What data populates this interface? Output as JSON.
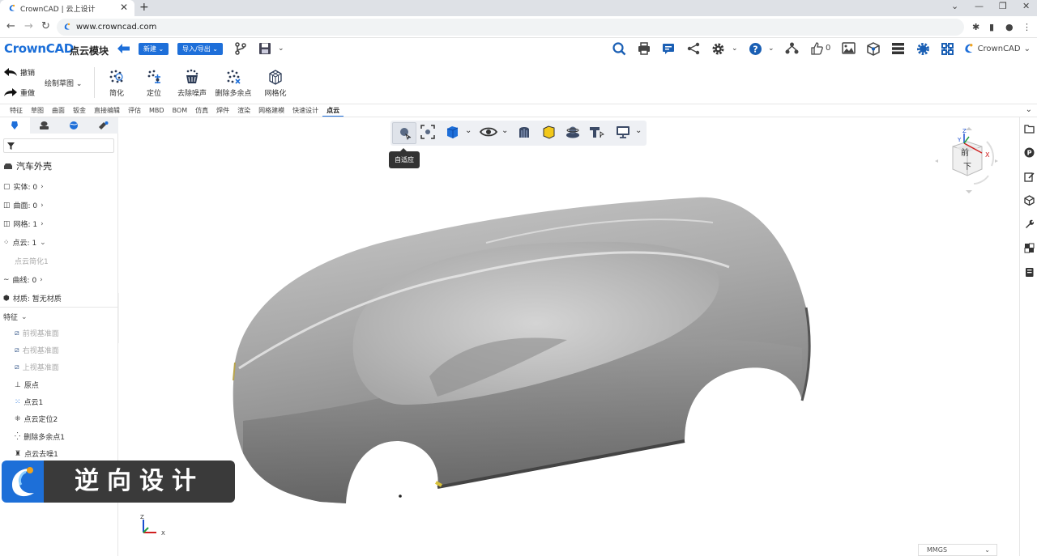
{
  "browser": {
    "tab_title": "CrownCAD | 云上设计",
    "tab_close": "✕",
    "new_tab": "+",
    "url": "www.crowncad.com",
    "window_controls": [
      "⌄",
      "—",
      "❐",
      "✕"
    ]
  },
  "header": {
    "brand": "CrownCAD",
    "module_title": "点云模块",
    "new_button": "新建",
    "import_export_button": "导入/导出",
    "like_count": "0",
    "user_label": "CrownCAD",
    "accent_color": "#1e6fd9"
  },
  "ribbon": {
    "undo": "撤销",
    "redo": "重做",
    "sketch": "绘制草图",
    "tools": [
      "简化",
      "定位",
      "去除噪声",
      "删除多余点",
      "网格化"
    ]
  },
  "menu_tabs": [
    "特征",
    "草图",
    "曲面",
    "钣金",
    "直接编辑",
    "评估",
    "MBD",
    "BOM",
    "仿真",
    "焊件",
    "渲染",
    "网格建模",
    "快速设计",
    "点云"
  ],
  "menu_active": "点云",
  "tree": {
    "title": "汽车外壳",
    "solid": "实体: 0",
    "surface": "曲面: 0",
    "mesh": "网格: 1",
    "pointcloud": "点云: 1",
    "pointcloud_child": "点云简化1",
    "curve": "曲线: 0",
    "material": "材质: 暂无材质",
    "features_header": "特征",
    "features": [
      "前视基准面",
      "右视基准面",
      "上视基准面",
      "原点",
      "点云1",
      "点云定位2",
      "删除多余点1",
      "点云去噪1"
    ]
  },
  "viewport": {
    "tooltip": "自适应",
    "viewcube_front": "前",
    "viewcube_bottom": "下",
    "axis_x": "X",
    "axis_y": "Y",
    "axis_z": "Z",
    "units": "MMGS"
  },
  "banner": {
    "text": "逆向设计"
  }
}
